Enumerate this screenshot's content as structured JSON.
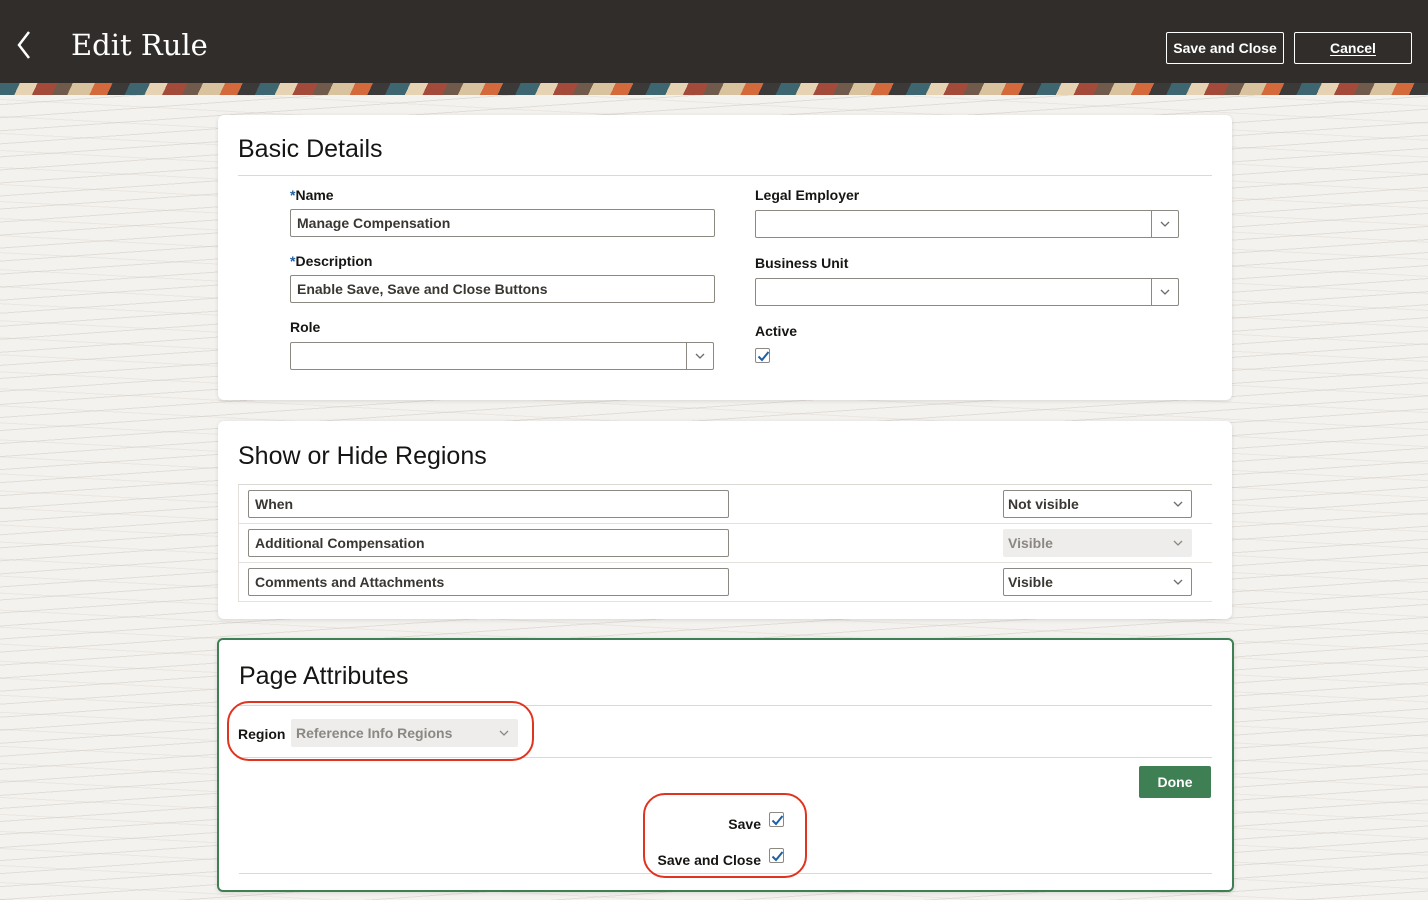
{
  "header": {
    "title": "Edit Rule",
    "save_and_close_label": "Save and Close",
    "cancel_label": "Cancel"
  },
  "basic_details": {
    "title": "Basic Details",
    "required_marker": "*",
    "name": {
      "label": "Name",
      "value": "Manage Compensation"
    },
    "description": {
      "label": "Description",
      "value": "Enable Save, Save and Close Buttons"
    },
    "role": {
      "label": "Role",
      "value": ""
    },
    "legal_employer": {
      "label": "Legal Employer",
      "value": ""
    },
    "business_unit": {
      "label": "Business Unit",
      "value": ""
    },
    "active": {
      "label": "Active",
      "checked": true
    }
  },
  "show_hide_regions": {
    "title": "Show or Hide Regions",
    "rows": [
      {
        "region": "When",
        "visibility": "Not visible",
        "disabled": false
      },
      {
        "region": "Additional Compensation",
        "visibility": "Visible",
        "disabled": true
      },
      {
        "region": "Comments and Attachments",
        "visibility": "Visible",
        "disabled": false
      }
    ]
  },
  "page_attributes": {
    "title": "Page Attributes",
    "region_label": "Region",
    "region_value": "Reference Info Regions",
    "done_label": "Done",
    "save": {
      "label": "Save",
      "checked": true
    },
    "save_and_close": {
      "label": "Save and Close",
      "checked": true
    }
  },
  "colors": {
    "header_bg": "#312d2a",
    "accent_green": "#3f7f54",
    "checkbox_blue": "#1f5fa8",
    "callout_red": "#e0341f"
  },
  "icons": [
    "back-chevron-icon",
    "chevron-down-icon",
    "checkmark-icon"
  ]
}
